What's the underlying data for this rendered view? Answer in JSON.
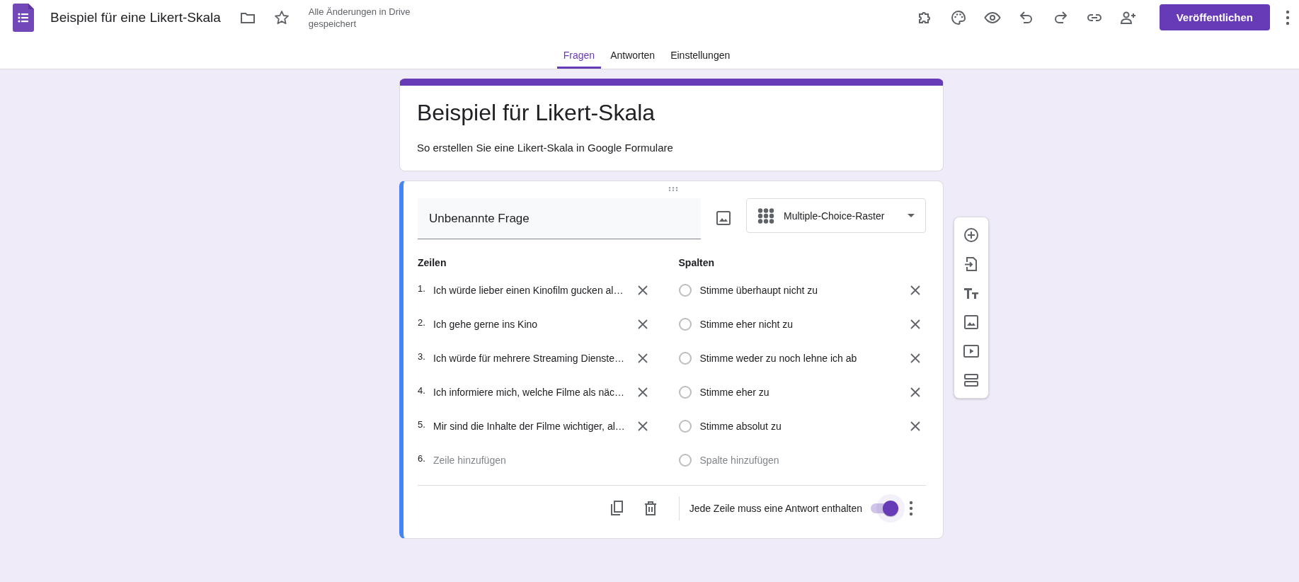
{
  "header": {
    "title": "Beispiel für eine Likert-Skala",
    "save_status": "Alle Änderungen in Drive gespeichert",
    "publish_button": "Veröffentlichen",
    "starred": false
  },
  "tabs": [
    {
      "label": "Fragen",
      "selected": true
    },
    {
      "label": "Antworten",
      "selected": false
    },
    {
      "label": "Einstellungen",
      "selected": false
    }
  ],
  "form": {
    "title": "Beispiel für Likert-Skala",
    "description": "So erstellen Sie eine Likert-Skala in Google Formulare"
  },
  "question": {
    "title": "Unbenannte Frage",
    "type": "Multiple-Choice-Raster",
    "rows_heading": "Zeilen",
    "columns_heading": "Spalten",
    "rows": [
      {
        "kind": "item",
        "number": "1.",
        "text": "Ich würde lieber einen Kinofilm gucken al…"
      },
      {
        "kind": "item",
        "number": "2.",
        "text": "Ich gehe gerne ins Kino"
      },
      {
        "kind": "item",
        "number": "3.",
        "text": "Ich würde für mehrere Streaming Dienste…"
      },
      {
        "kind": "item",
        "number": "4.",
        "text": "Ich informiere mich, welche Filme als näc…"
      },
      {
        "kind": "item",
        "number": "5.",
        "text": "Mir sind die Inhalte der Filme wichtiger, al…"
      },
      {
        "kind": "add",
        "number": "6.",
        "text": "Zeile hinzufügen"
      }
    ],
    "columns": [
      {
        "kind": "item",
        "text": "Stimme überhaupt nicht zu",
        "checked": false
      },
      {
        "kind": "item",
        "text": "Stimme eher nicht zu",
        "checked": false
      },
      {
        "kind": "item",
        "text": "Stimme weder zu noch lehne ich ab",
        "checked": false
      },
      {
        "kind": "item",
        "text": "Stimme eher zu",
        "checked": false
      },
      {
        "kind": "item",
        "text": "Stimme absolut zu",
        "checked": false
      },
      {
        "kind": "add",
        "text": "Spalte hinzufügen",
        "checked": false
      }
    ],
    "required_label": "Jede Zeile muss eine Antwort enthalten",
    "required": true
  }
}
